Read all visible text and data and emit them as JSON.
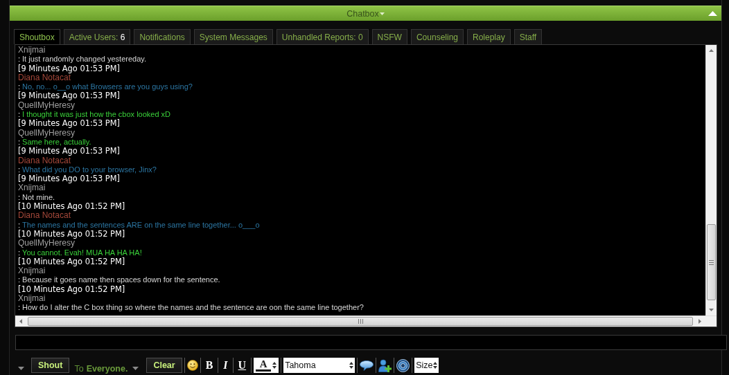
{
  "header": {
    "title": "Chatbox"
  },
  "tabs": [
    {
      "label": "Shoutbox",
      "selected": true
    },
    {
      "label": "Active Users:",
      "count": "6",
      "selected": false
    },
    {
      "label": "Notifications",
      "selected": false
    },
    {
      "label": "System Messages",
      "selected": false
    },
    {
      "label": "Unhandled Reports: 0",
      "selected": false
    },
    {
      "label": "NSFW",
      "selected": false
    },
    {
      "label": "Counseling",
      "selected": false
    },
    {
      "label": "Roleplay",
      "selected": false
    },
    {
      "label": "Staff",
      "selected": false
    }
  ],
  "messages": [
    {
      "user": {
        "name": "Xnijmai",
        "color": "#a0a0a0"
      },
      "separator": ":",
      "text": "It just randomly changed yestereday.",
      "color": "#d8d8d8"
    },
    {
      "time": "[9 Minutes Ago 01:53 PM]",
      "user": {
        "name": "Diana Notacat",
        "color": "#a5483a"
      },
      "separator": ":",
      "text": "No, no... o__o what Browsers are you guys using?",
      "color": "#2c77a4"
    },
    {
      "time": "[9 Minutes Ago 01:53 PM]",
      "user": {
        "name": "QuellMyHeresy",
        "color": "#a0a0a0"
      },
      "separator": ":",
      "text": "I thought it was just how the cbox looked xD",
      "color": "#3ad23a"
    },
    {
      "time": "[9 Minutes Ago 01:53 PM]",
      "user": {
        "name": "QuellMyHeresy",
        "color": "#a0a0a0"
      },
      "separator": ":",
      "text": "Same here, actually.",
      "color": "#3ad23a"
    },
    {
      "time": "[9 Minutes Ago 01:53 PM]",
      "user": {
        "name": "Diana Notacat",
        "color": "#a5483a"
      },
      "separator": ":",
      "text": "What did you DO to your browser, Jinx?",
      "color": "#2c77a4"
    },
    {
      "time": "[9 Minutes Ago 01:53 PM]",
      "user": {
        "name": "Xnijmai",
        "color": "#a0a0a0"
      },
      "separator": ":",
      "text": "Not mine.",
      "color": "#d8d8d8"
    },
    {
      "time": "[10 Minutes Ago 01:52 PM]",
      "user": {
        "name": "Diana Notacat",
        "color": "#a5483a"
      },
      "separator": ":",
      "text": "The names and the sentences ARE on the same line together... o___o",
      "color": "#2c77a4"
    },
    {
      "time": "[10 Minutes Ago 01:52 PM]",
      "user": {
        "name": "QuellMyHeresy",
        "color": "#a0a0a0"
      },
      "separator": ":",
      "text": "You cannot. Evah! MUA HA HA HA!",
      "color": "#3ad23a"
    },
    {
      "time": "[10 Minutes Ago 01:52 PM]",
      "user": {
        "name": "Xnijmai",
        "color": "#a0a0a0"
      },
      "separator": ":",
      "text": "Because it goes name then spaces down for the sentence.",
      "color": "#d8d8d8"
    },
    {
      "time": "[10 Minutes Ago 01:52 PM]",
      "user": {
        "name": "Xnijmai",
        "color": "#a0a0a0"
      },
      "separator": ":",
      "text": "How do I alter the C box thing so where the names and the sentence are oon the same line together?",
      "color": "#d8d8d8"
    }
  ],
  "toolbar": {
    "shout_button": "Shout",
    "recipient_prefix": "To",
    "recipient": "Everyone.",
    "clear_button": "Clear",
    "bold_button": "B",
    "italic_button": "I",
    "underline_button": "U",
    "font_color": "A",
    "font": "Tahoma",
    "size": "Size"
  }
}
